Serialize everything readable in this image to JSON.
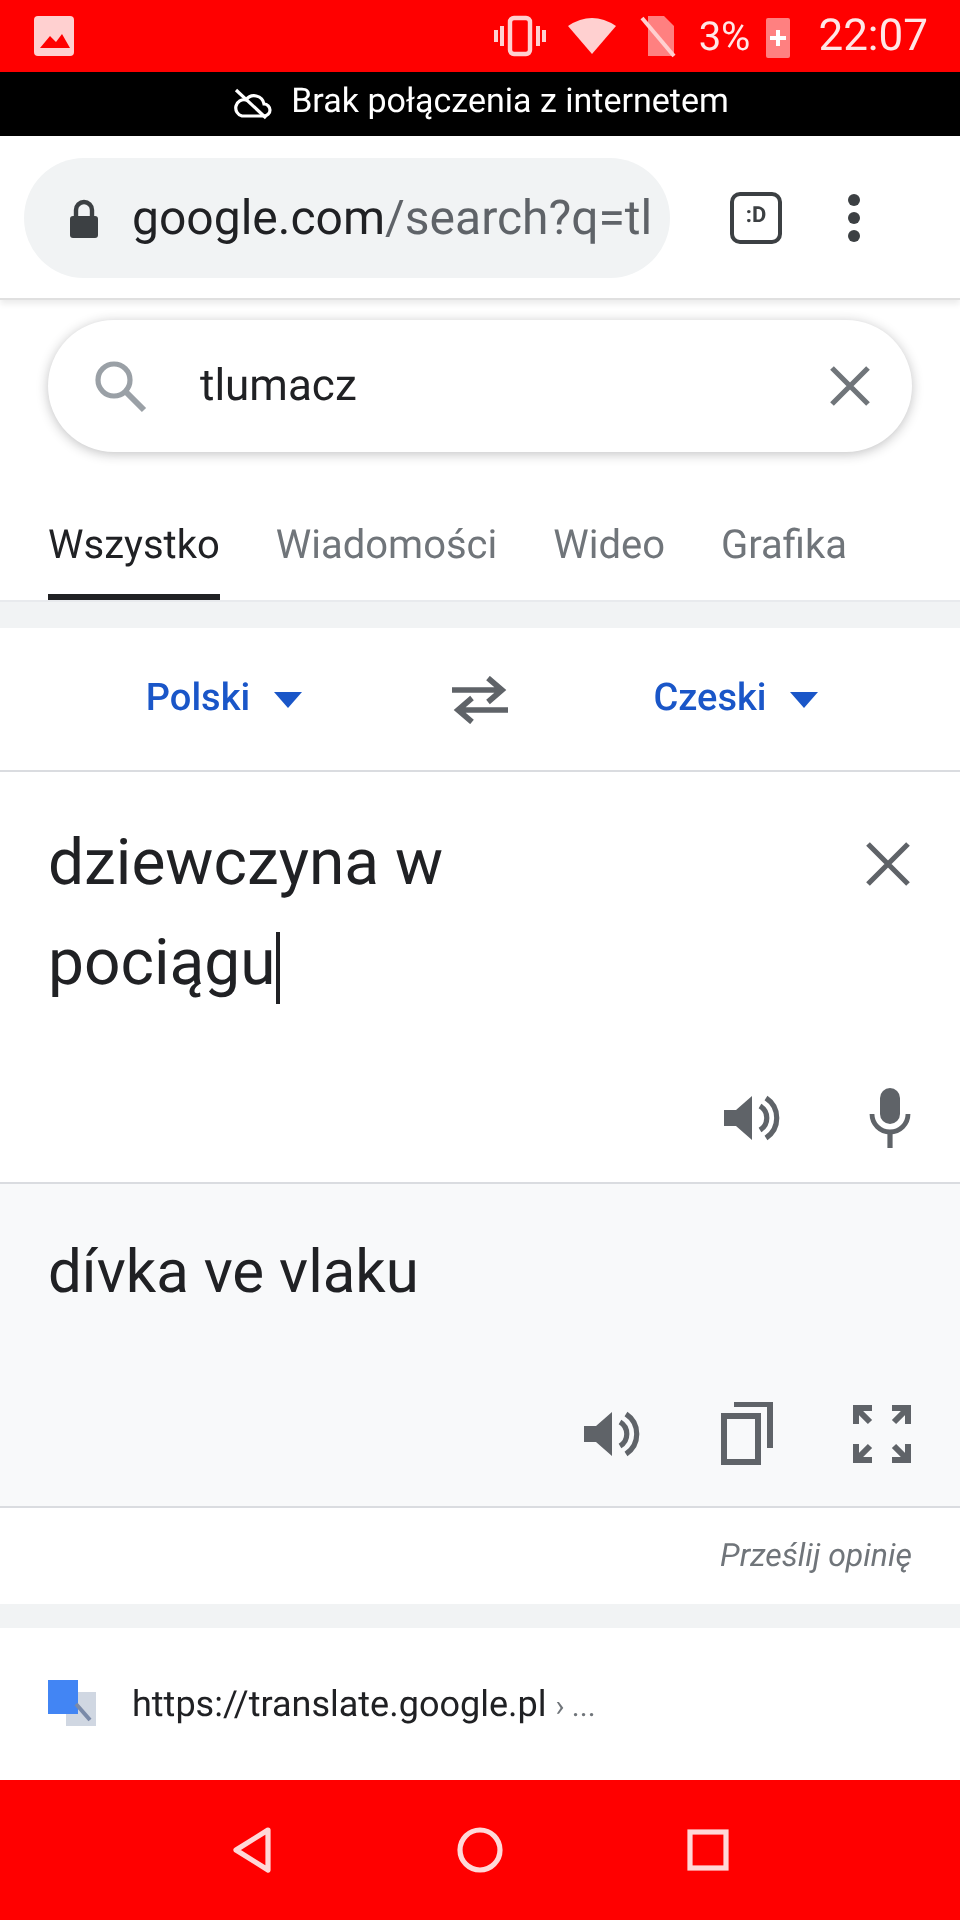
{
  "status_bar": {
    "battery": "3%",
    "time": "22:07"
  },
  "offline_banner": {
    "text": "Brak połączenia z internetem"
  },
  "address_bar": {
    "host": "google.com",
    "path": "/search?q=tl",
    "tab_button": ":D"
  },
  "search": {
    "value": "tlumacz"
  },
  "tabs": [
    {
      "label": "Wszystko",
      "selected": true
    },
    {
      "label": "Wiadomości",
      "selected": false
    },
    {
      "label": "Wideo",
      "selected": false
    },
    {
      "label": "Grafika",
      "selected": false
    }
  ],
  "translator": {
    "source_language": "Polski",
    "target_language": "Czeski",
    "input": "dziewczyna w pociągu",
    "output": "dívka ve vlaku",
    "feedback": "Prześlij opinię"
  },
  "result": {
    "url": "https://translate.google.pl",
    "breadcrumb": "› ..."
  }
}
